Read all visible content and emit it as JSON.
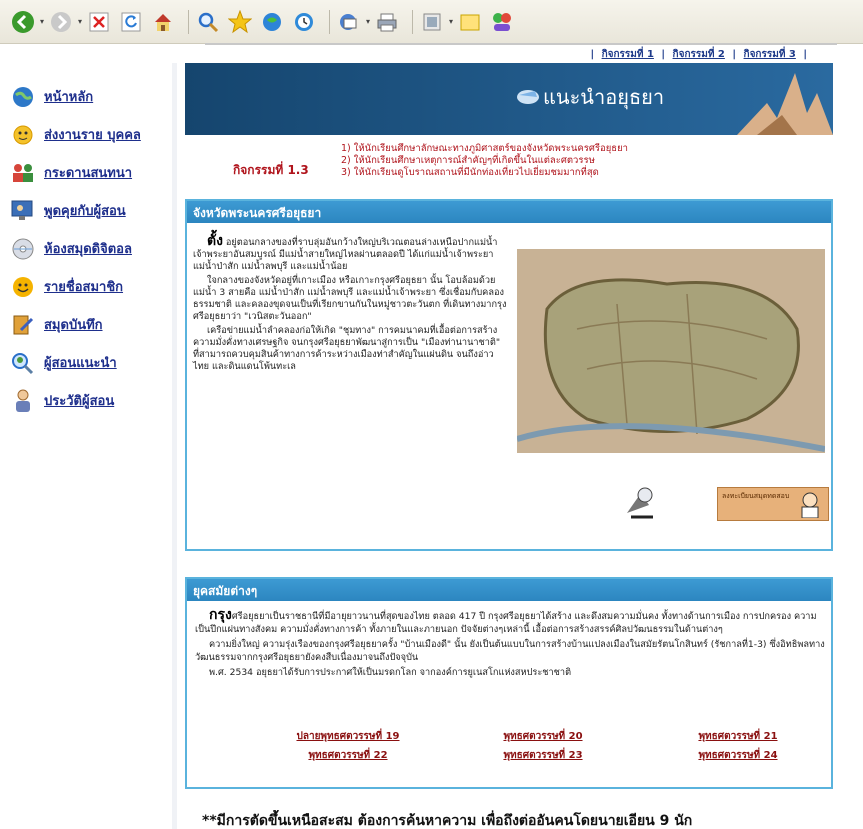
{
  "toolbar": {
    "buttons": [
      "back-icon",
      "forward-icon",
      "stop-icon",
      "refresh-icon",
      "home-icon",
      "search-icon",
      "favorites-icon",
      "media-icon",
      "history-icon",
      "mail-icon",
      "print-icon",
      "edit-icon",
      "discuss-icon",
      "messenger-icon"
    ]
  },
  "tabs": [
    {
      "label": "กิจกรรมที่ 1"
    },
    {
      "label": "กิจกรรมที่ 2"
    },
    {
      "label": "กิจกรรมที่ 3"
    }
  ],
  "nav": [
    {
      "label": "หน้าหลัก",
      "icon": "globe-icon"
    },
    {
      "label": "ส่งงานราย บุคคล",
      "icon": "sun-face-icon"
    },
    {
      "label": "กระดานสนทนา",
      "icon": "people-icon"
    },
    {
      "label": "พูดคุยกับผู้สอน",
      "icon": "monitor-people-icon"
    },
    {
      "label": "ห้องสมุดดิจิตอล",
      "icon": "dvd-icon"
    },
    {
      "label": "รายชื่อสมาชิก",
      "icon": "smiley-icon"
    },
    {
      "label": "สมุดบันทึก",
      "icon": "notebook-icon"
    },
    {
      "label": "ผู้สอนแนะนำ",
      "icon": "magnifier-person-icon"
    },
    {
      "label": "ประวัติผู้สอน",
      "icon": "teacher-icon"
    }
  ],
  "banner": {
    "title": "แนะนำอยุธยา"
  },
  "activity": {
    "label": "กิจกรรมที่ 1.3",
    "items": [
      "1) ให้นักเรียนศึกษาลักษณะทางภูมิศาสตร์ของจังหวัดพระนครศรีอยุธยา",
      "2) ให้นักเรียนศึกษาเหตุการณ์สำคัญๆที่เกิดขึ้นในแต่ละศตวรรษ",
      "3) ให้นักเรียนดูโบราณสถานที่มีนักท่องเที่ยวไปเยี่ยมชมมากที่สุด"
    ]
  },
  "panel1": {
    "heading": "จังหวัดพระนครศรีอยุธยา",
    "dropcap": "ตั้ง",
    "paragraphs": [
      "อยู่ตอนกลางของที่ราบลุ่มอันกว้างใหญ่บริเวณตอนล่างเหนือปากแม่น้ำเจ้าพระยาอันสมบูรณ์ มีแม่น้ำสายใหญ่ไหลผ่านตลอดปี ได้แก่แม่น้ำเจ้าพระยา แม่น้ำป่าสัก แม่น้ำลพบุรี และแม่น้ำน้อย",
      "ใจกลางของจังหวัดอยู่ที่เกาะเมือง หรือเกาะกรุงศรีอยุธยา นั้น โอบล้อมด้วยแม่น้ำ 3 สายคือ แม่น้ำป่าสัก แม่น้ำลพบุรี และแม่น้ำเจ้าพระยา ซึ่งเชื่อมกับคลองธรรมชาติ และคลองขุดจนเป็นที่เรียกขานกันในหมู่ชาวตะวันตก ที่เดินทางมากรุงศรีอยุธยาว่า \"เวนิสตะวันออก\"",
      "เครือข่ายแม่น้ำลำคลองก่อให้เกิด \"ชุมทาง\" การคมนาคมที่เอื้อต่อการสร้างความมั่งคั่งทางเศรษฐกิจ จนกรุงศรีอยุธยาพัฒนาสู่การเป็น \"เมืองท่านานาชาติ\" ที่สามารถควบคุมสินค้าทางการค้าระหว่างเมืองท่าสำคัญในแผ่นดิน จนถึงอ่าวไทย และดินแดนโพ้นทะเล"
    ],
    "badge_text": "ลงทะเบียนสมุดทดสอบ"
  },
  "panel2": {
    "heading": "ยุคสมัยต่างๆ",
    "dropcap": "กรุง",
    "paragraphs": [
      "ศรีอยุธยาเป็นราชธานีที่มีอายุยาวนานที่สุดของไทย ตลอด 417 ปี กรุงศรีอยุธยาได้สร้าง และดึงสมความมั่นคง ทั้งทางด้านการเมือง การปกครอง ความเป็นปึกแผ่นทางสังคม ความมั่งคั่งทางการค้า ทั้งภายในและภายนอก ปัจจัยต่างๆเหล่านี้ เอื้อต่อการสร้างสรรค์ศิลปวัฒนธรรมในด้านต่างๆ",
      "ความยิ่งใหญ่ ความรุ่งเรืองของกรุงศรีอยุธยาครั้ง \"บ้านเมืองดี\" นั้น ยังเป็นต้นแบบในการสร้างบ้านแปลงเมืองในสมัยรัตนโกสินทร์ (รัชกาลที่1-3) ซึ่งอิทธิพลทางวัฒนธรรมจากกรุงศรีอยุธยายังคงสืบเนื่องมาจนถึงปัจจุบัน",
      "พ.ศ. 2534 อยุธยาได้รับการประกาศให้เป็นมรดกโลก จากองค์การยูเนสโกแห่งสหประชาชาติ"
    ],
    "links": [
      [
        "ปลายพุทธศตวรรษที่ 19",
        "พุทธศตวรรษที่ 20",
        "พุทธศตวรรษที่ 21"
      ],
      [
        "พุทธศตวรรษที่ 22",
        "พุทธศตวรรษที่ 23",
        "พุทธศตวรรษที่ 24"
      ]
    ]
  },
  "footer": {
    "note": "**มีการตัดขึ้นเหนือสะสม ต้องการค้นหาความ เพื่อถึงต่ออันคนโดยนายเอียน 9 นัก"
  },
  "colors": {
    "banner": "#1f5a8c",
    "panel_border": "#5ab3dd",
    "link": "#1e2f8c",
    "activity": "#b0141c"
  }
}
